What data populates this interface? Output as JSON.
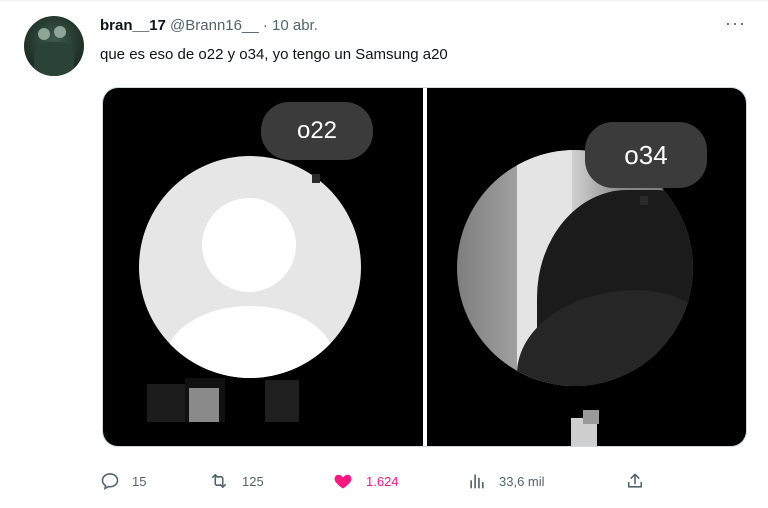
{
  "tweet": {
    "author_name": "bran__17",
    "handle": "@Brann16__",
    "separator": "·",
    "date": "10 abr.",
    "text": "que es eso de o22 y o34, yo tengo un Samsung a20",
    "more_icon": "more-horizontal-icon"
  },
  "media": {
    "left_label": "o22",
    "right_label": "o34"
  },
  "actions": {
    "replies": "15",
    "retweets": "125",
    "likes": "1.624",
    "views": "33,6 mil"
  },
  "colors": {
    "like": "#f91880",
    "secondary_text": "#536471",
    "bubble": "#3b3b3b"
  }
}
